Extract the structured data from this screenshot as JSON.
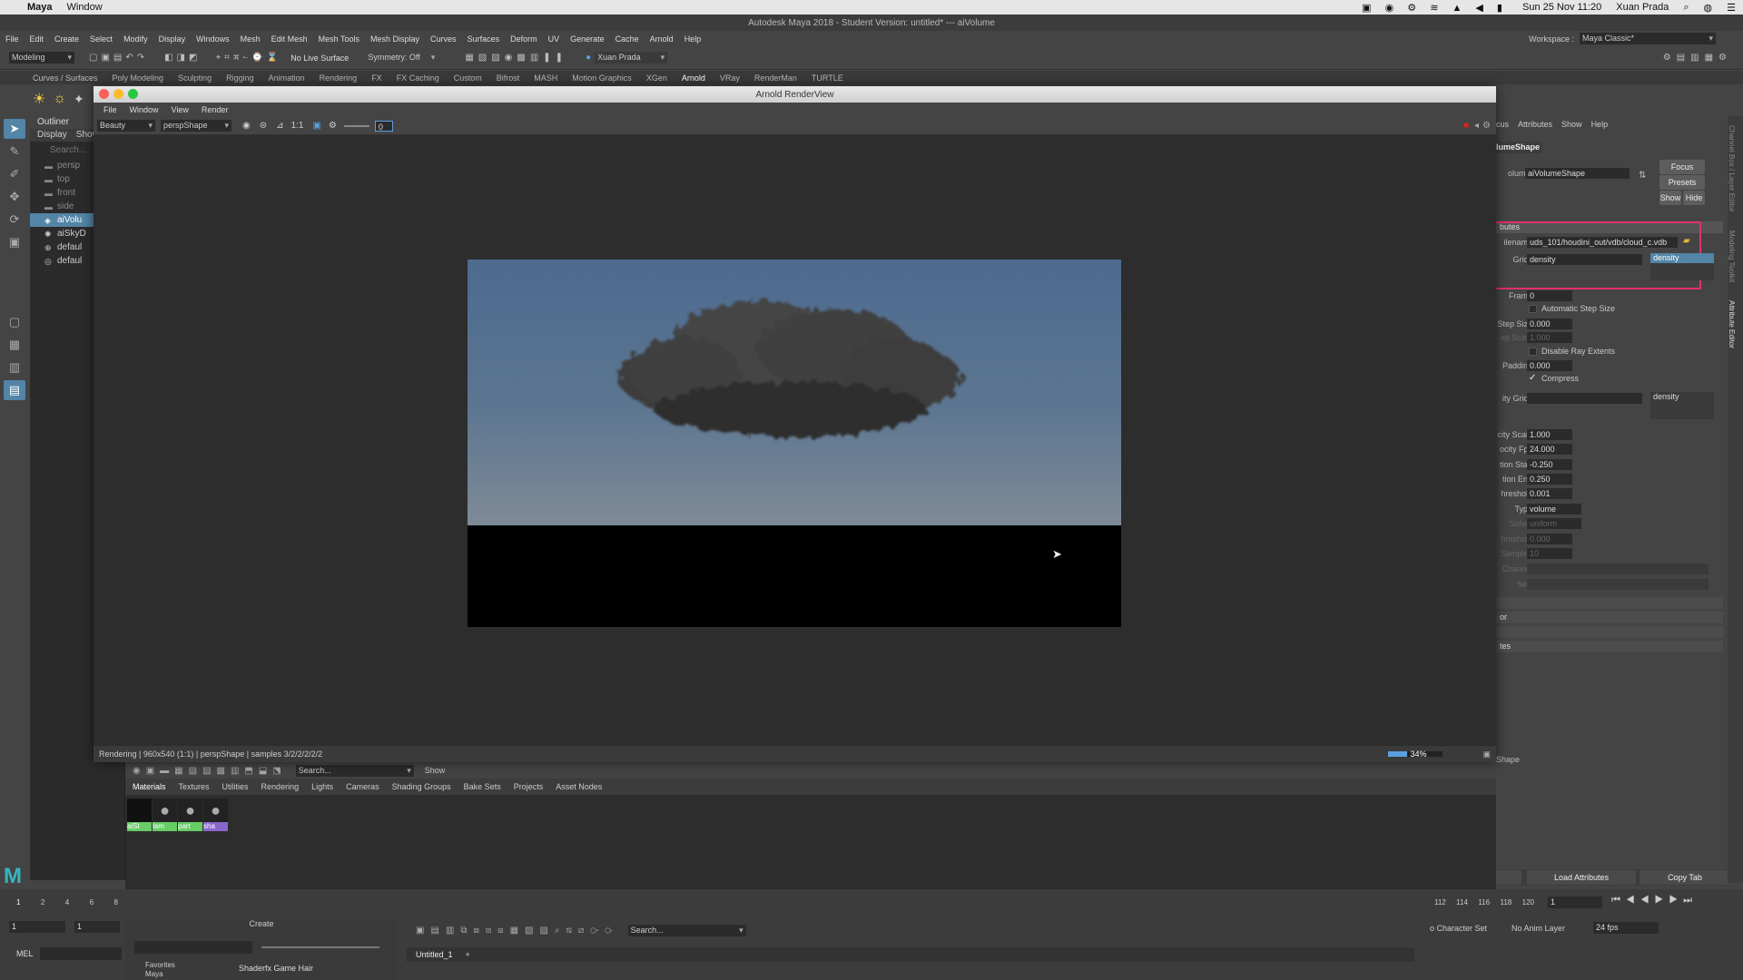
{
  "mac": {
    "app": "Maya",
    "menus": [
      "Window"
    ],
    "clock": "Sun 25 Nov 11:20",
    "user": "Xuan Prada"
  },
  "window_title": "Autodesk Maya 2018 - Student Version: untitled*   ---   aiVolume",
  "menubar": {
    "items": [
      "File",
      "Edit",
      "Create",
      "Select",
      "Modify",
      "Display",
      "Windows",
      "Mesh",
      "Edit Mesh",
      "Mesh Tools",
      "Mesh Display",
      "Curves",
      "Surfaces",
      "Deform",
      "UV",
      "Generate",
      "Cache",
      "Arnold",
      "Help"
    ],
    "workspace_label": "Workspace :",
    "workspace_value": "Maya Classic*"
  },
  "statusline": {
    "mode": "Modeling",
    "live_surface": "No Live Surface",
    "symmetry": "Symmetry: Off",
    "user": "Xuan Prada"
  },
  "shelf_tabs": [
    "Curves / Surfaces",
    "Poly Modeling",
    "Sculpting",
    "Rigging",
    "Animation",
    "Rendering",
    "FX",
    "FX Caching",
    "Custom",
    "Bifrost",
    "MASH",
    "Motion Graphics",
    "XGen",
    "Arnold",
    "VRay",
    "RenderMan",
    "TURTLE"
  ],
  "shelf_active": "Arnold",
  "outliner": {
    "title": "Outliner",
    "menus": [
      "Display",
      "Show"
    ],
    "search_placeholder": "Search...",
    "items": [
      "persp",
      "top",
      "front",
      "side",
      "aiVolu",
      "aiSkyD",
      "defaul",
      "defaul"
    ]
  },
  "renderview": {
    "title": "Arnold RenderView",
    "menus": [
      "File",
      "Window",
      "View",
      "Render"
    ],
    "aov": "Beauty",
    "camera": "perspShape",
    "ratio": "1:1",
    "frame_value": "0",
    "status": "Rendering | 960x540 (1:1) | perspShape  | samples 3/2/2/2/2/2",
    "progress_label": "34%",
    "progress": 0.34
  },
  "attr": {
    "tabs": [
      "cus",
      "Attributes",
      "Show",
      "Help"
    ],
    "node": "lumeShape",
    "volume_label": "olume:",
    "volume_value": "aiVolumeShape",
    "buttons": [
      "Focus",
      "Presets",
      "Show",
      "Hide"
    ],
    "section_label": "butes",
    "filename_label": "ilename",
    "filename_value": "uds_101/houdini_out/vdb/cloud_c.vdb",
    "grids_label": "Grids",
    "grids_value": "density",
    "grids_list": "density",
    "frame_label": "Frame",
    "frame_value": "0",
    "auto_step": "Automatic Step Size",
    "step_size_label": "Step Size",
    "step_size_value": "0.000",
    "step_scale_label": "ep Scale",
    "step_scale_value": "1.000",
    "disable_ray": "Disable Ray Extents",
    "padding_label": "Padding",
    "padding_value": "0.000",
    "compress": "Compress",
    "vel_grids_label": "ity Grids",
    "vel_grids_list": "density",
    "vel_scale_label": "city Scale",
    "vel_scale_value": "1.000",
    "vel_fps_label": "ocity Fps",
    "vel_fps_value": "24.000",
    "motion_start_label": "tion Start",
    "motion_start_value": "-0.250",
    "motion_end_label": "tion End",
    "motion_end_value": "0.250",
    "threshold_label": "hreshold",
    "threshold_value": "0.001",
    "type_label": "Type",
    "type_value": "volume",
    "solver_label": "Solver",
    "solver_value": "uniform",
    "threshold2_label": "hreshold",
    "threshold2_value": "0.000",
    "samples_label": "Samples",
    "samples_value": "10",
    "channel_label": "Channel",
    "field_label": "field",
    "sec2": "or",
    "sec3": "tes",
    "bottom_buttons": [
      "Select",
      "Load Attributes",
      "Copy Tab"
    ],
    "shape_tag": "Shape"
  },
  "hypershade": {
    "tabs": [
      "Materials",
      "Textures",
      "Utilities",
      "Rendering",
      "Lights",
      "Cameras",
      "Shading Groups",
      "Bake Sets",
      "Projects",
      "Asset Nodes"
    ],
    "search_placeholder": "Search...",
    "show": "Show",
    "swatches": [
      "aiSt",
      "lam",
      "part",
      "sha"
    ],
    "create_label": "Create",
    "favorites": "Favorites",
    "maya": "Maya",
    "shaderfx": "Shaderfx Game Hair",
    "tab_untitled": "Untitled_1",
    "search2": "Search..."
  },
  "timeline": {
    "ticks_left": [
      "1",
      "2",
      "4",
      "6",
      "8"
    ],
    "ticks_right": [
      "112",
      "114",
      "116",
      "118",
      "120"
    ],
    "start": "1",
    "start2": "1",
    "current": "1",
    "mel": "MEL",
    "character": "o Character Set",
    "anim_layer": "No Anim Layer",
    "fps": "24 fps"
  }
}
